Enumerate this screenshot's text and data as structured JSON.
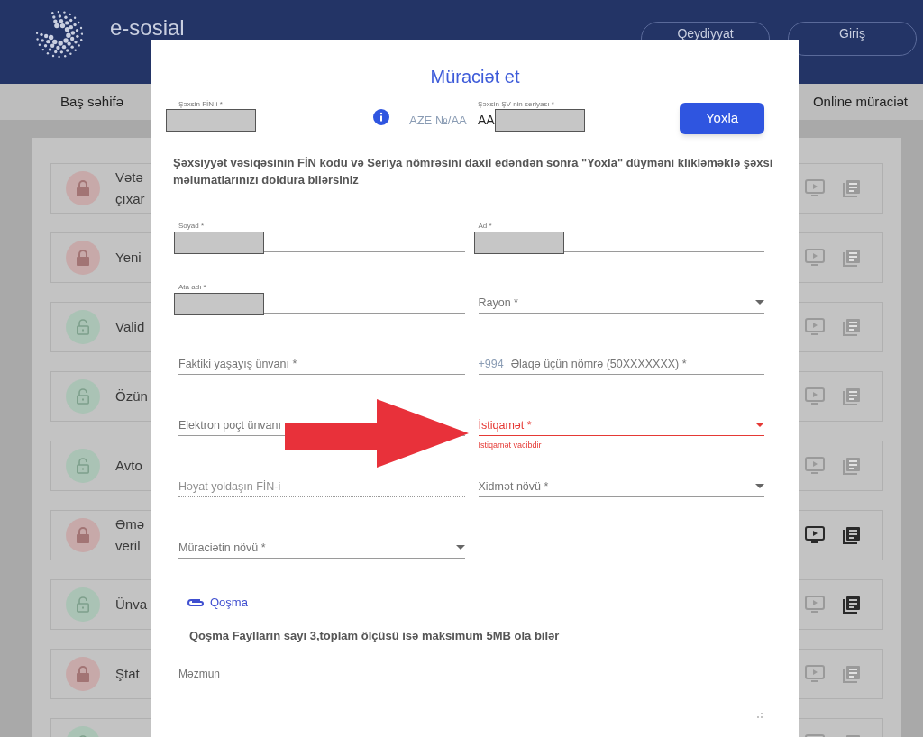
{
  "header": {
    "brand": "e-sosial",
    "buttons": [
      "Qeydiyyat",
      "Giriş"
    ]
  },
  "nav": {
    "items": [
      "Baş səhifə",
      "Online müraciət"
    ]
  },
  "services": [
    {
      "title_lines": [
        "Vətə",
        "çıxar"
      ],
      "locked": true,
      "actions": [
        {
          "kind": "tv",
          "active": false
        },
        {
          "kind": "list",
          "active": false
        }
      ]
    },
    {
      "title_lines": [
        "Yeni"
      ],
      "locked": true,
      "actions": [
        {
          "kind": "tv",
          "active": false
        },
        {
          "kind": "list",
          "active": false
        }
      ]
    },
    {
      "title_lines": [
        "Valid"
      ],
      "locked": false,
      "actions": [
        {
          "kind": "tv",
          "active": false
        },
        {
          "kind": "list",
          "active": false
        }
      ]
    },
    {
      "title_lines": [
        "Özün"
      ],
      "locked": false,
      "actions": [
        {
          "kind": "tv",
          "active": false
        },
        {
          "kind": "list",
          "active": false
        }
      ]
    },
    {
      "title_lines": [
        "Avto"
      ],
      "locked": false,
      "actions": [
        {
          "kind": "tv",
          "active": false
        },
        {
          "kind": "list",
          "active": false
        }
      ]
    },
    {
      "title_lines": [
        "Əmə",
        "veril"
      ],
      "locked": true,
      "actions": [
        {
          "kind": "tv",
          "active": true
        },
        {
          "kind": "list",
          "active": true
        }
      ]
    },
    {
      "title_lines": [
        "Ünva"
      ],
      "locked": false,
      "actions": [
        {
          "kind": "tv",
          "active": false
        },
        {
          "kind": "list",
          "active": true
        }
      ]
    },
    {
      "title_lines": [
        "Ştat"
      ],
      "locked": true,
      "actions": [
        {
          "kind": "tv",
          "active": false
        },
        {
          "kind": "list",
          "active": false
        }
      ]
    },
    {
      "locked": false,
      "actions": [
        {
          "kind": "tv",
          "active": false
        },
        {
          "kind": "list",
          "active": false
        }
      ]
    }
  ],
  "dialog": {
    "title": "Müraciət et",
    "check_row": {
      "fin_label": "Şəxsin FİN-i *",
      "doc_prefix": "AZE №/AA",
      "series_label": "Şəxsin ŞV-nin seriyası *",
      "series_value": "AA",
      "button": "Yoxla"
    },
    "note": "Şəxsiyyət vəsiqəsinin FİN kodu və Seriya nömrəsini daxil edəndən sonra \"Yoxla\" düyməni klikləməklə şəxsi məlumatlarınızı doldura bilərsiniz",
    "fields": [
      {
        "kind": "redacted",
        "label": "Soyad *",
        "error": false,
        "disabled": false
      },
      {
        "kind": "redacted",
        "label": "Ad *",
        "error": false,
        "disabled": false
      },
      {
        "kind": "redacted",
        "label": "Ata adı *",
        "error": false,
        "disabled": false
      },
      {
        "kind": "select",
        "label": "Rayon *",
        "error": false,
        "disabled": false
      },
      {
        "kind": "text",
        "label": "Faktiki yaşayış ünvanı *",
        "error": false,
        "disabled": false
      },
      {
        "kind": "text",
        "label": "Əlaqə üçün nömrə (50XXXXXXX) *",
        "prefix": "+994",
        "error": false,
        "disabled": false
      },
      {
        "kind": "text",
        "label": "Elektron poçt ünvanı",
        "error": false,
        "disabled": false
      },
      {
        "kind": "select",
        "label": "İstiqamət *",
        "error": true,
        "error_text": "İstiqamət vacibdir",
        "disabled": false
      },
      {
        "kind": "text",
        "label": "Həyat yoldaşın FİN-i",
        "error": false,
        "disabled": true
      },
      {
        "kind": "select",
        "label": "Xidmət növü *",
        "error": false,
        "disabled": false
      },
      {
        "kind": "select",
        "label": "Müraciətin növü *",
        "error": false,
        "disabled": false
      }
    ],
    "attachment": {
      "link": "Qoşma",
      "note": "Qoşma Faylların sayı 3,toplam ölçüsü isə maksimum 5MB ola bilər"
    },
    "content_label": "Məzmun"
  }
}
